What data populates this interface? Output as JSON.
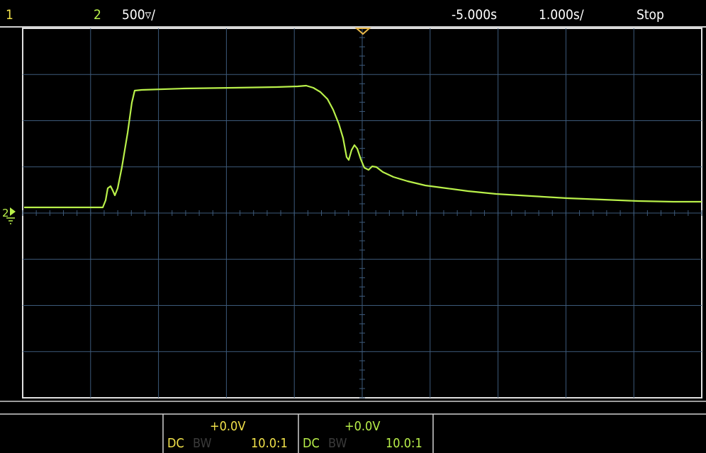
{
  "top": {
    "ch1_label": "1",
    "ch2_label": "2",
    "vscale": "500▿/",
    "delay": "-5.000s",
    "timebase": "1.000s/",
    "run_state": "Stop"
  },
  "markers": {
    "ground_label": "2"
  },
  "bottom": {
    "ch1": {
      "offset": "+0.0V",
      "coupling": "DC",
      "bw": "BW",
      "probe": "10.0:1"
    },
    "ch2": {
      "offset": "+0.0V",
      "coupling": "DC",
      "bw": "BW",
      "probe": "10.0:1"
    }
  },
  "colors": {
    "ch1": "#f2e24a",
    "ch2": "#b9f04a",
    "grid": "#3d5a7a",
    "trigger_marker": "#e8b84a"
  }
}
